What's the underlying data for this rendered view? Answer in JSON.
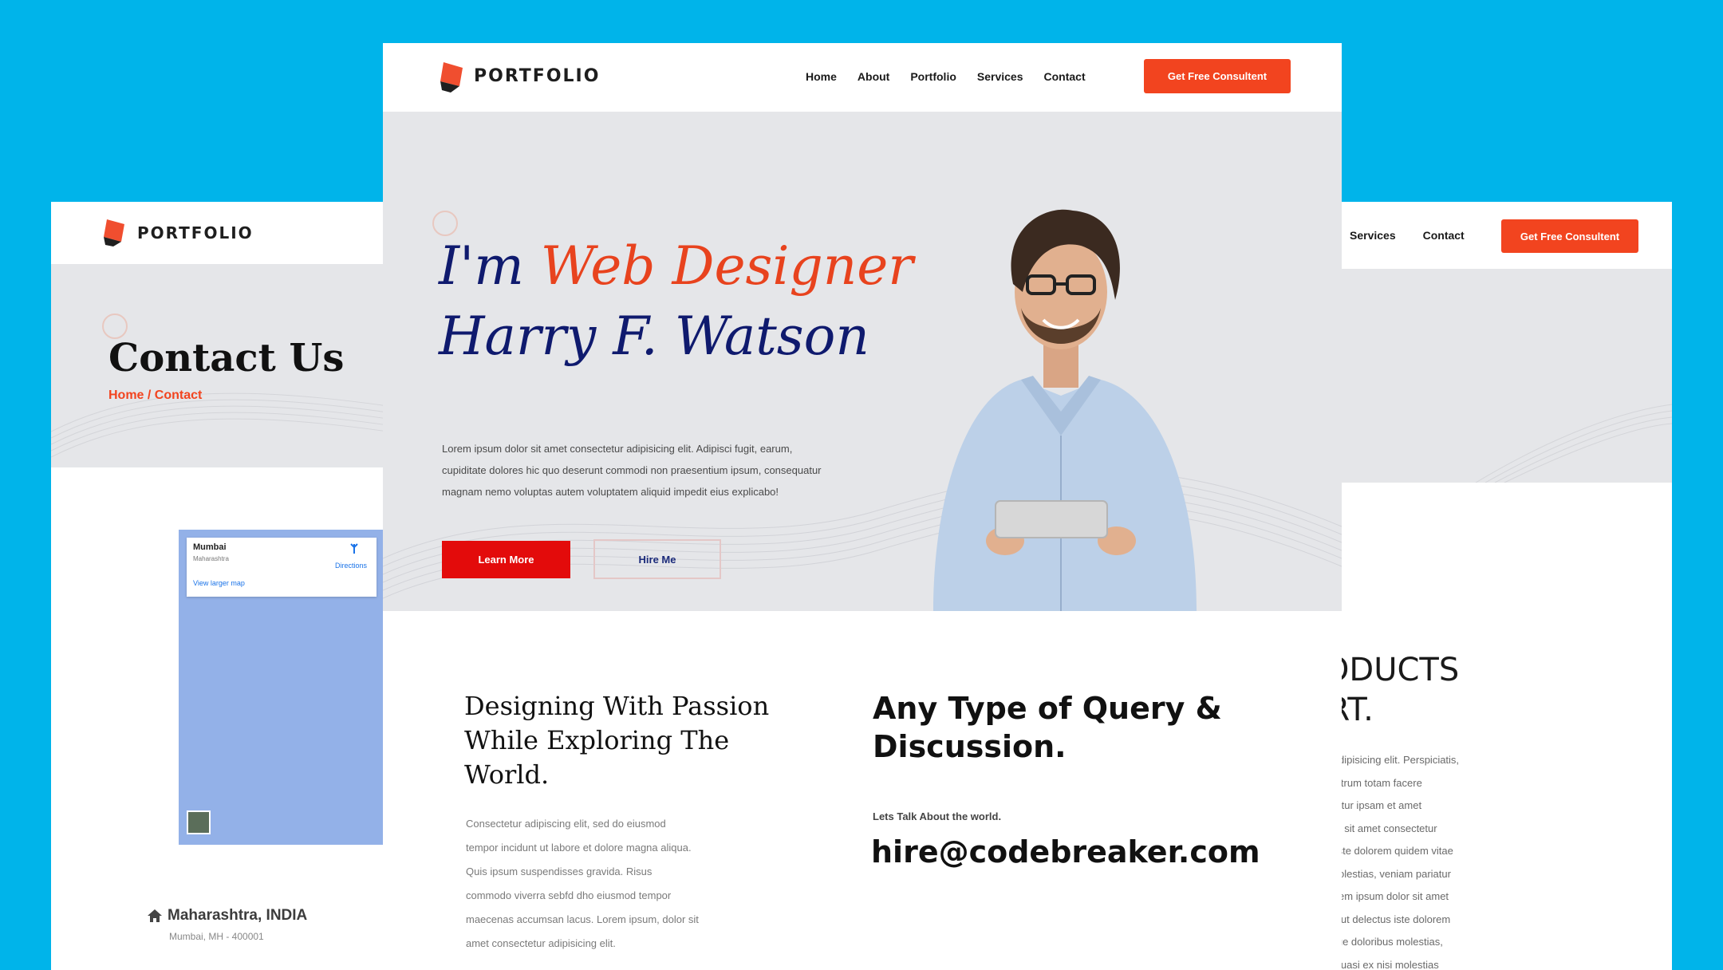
{
  "left_card": {
    "logo": "PORTFOLIO",
    "page_title": "Contact Us",
    "breadcrumb": "Home / Contact",
    "map": {
      "place": "Mumbai",
      "region": "Maharashtra",
      "directions": "Directions",
      "view_larger": "View larger map"
    },
    "address_title": "Maharashtra, INDIA",
    "address_sub": "Mumbai, MH - 400001"
  },
  "main_card": {
    "logo": "PORTFOLIO",
    "nav": [
      "Home",
      "About",
      "Portfolio",
      "Services",
      "Contact"
    ],
    "cta": "Get Free Consultent",
    "hero": {
      "line1_prefix": "I'm ",
      "line1_highlight": "Web Designer",
      "line2": "Harry F. Watson",
      "text_lines": [
        "Lorem ipsum dolor sit amet consectetur adipisicing elit. Adipisci fugit, earum,",
        "cupiditate dolores hic quo deserunt commodi non praesentium ipsum, consequatur",
        "magnam nemo voluptas autem voluptatem aliquid impedit eius explicabo!"
      ],
      "btn_primary": "Learn More",
      "btn_secondary": "Hire Me"
    },
    "about": {
      "heading_lines": [
        "Designing With Passion",
        "While Exploring The",
        "World."
      ],
      "text_lines": [
        "Consectetur adipiscing elit, sed do eiusmod",
        "tempor incidunt ut labore et dolore magna aliqua.",
        "Quis ipsum suspendisses gravida. Risus",
        "commodo viverra sebfd dho eiusmod tempor",
        "maecenas accumsan lacus. Lorem ipsum, dolor sit",
        "amet consectetur adipisicing elit."
      ]
    },
    "contact": {
      "heading_lines": [
        "Any Type of Query &",
        "Discussion."
      ],
      "label": "Lets Talk About the world.",
      "email": "hire@codebreaker.com"
    }
  },
  "right_card": {
    "nav": [
      "Services",
      "Contact"
    ],
    "cta": "Get Free Consultent",
    "heading_lines": [
      "PRODUCTS",
      "T ART."
    ],
    "text_lines": [
      "consectetur adipisicing elit. Perspiciatis,",
      "dem vitae nostrum totam facere",
      ", veniam pariatur ipsam et amet",
      "m ipsum dolor sit amet consectetur",
      "aut delectus iste dolorem quidem vitae",
      "e doloribus molestias, veniam pariatur",
      "si oa quol Lorem ipsum dolor sit amet",
      "Perspiciatis, aut delectus iste dolorem",
      "facere similique doloribus molestias,",
      "el commodi, quasi ex nisi molestias"
    ]
  },
  "colors": {
    "background": "#00b4ea",
    "accent_orange": "#f2441f",
    "button_red": "#e30b0b",
    "navy": "#0f1a6e",
    "hero_bg": "#e5e6e9"
  }
}
